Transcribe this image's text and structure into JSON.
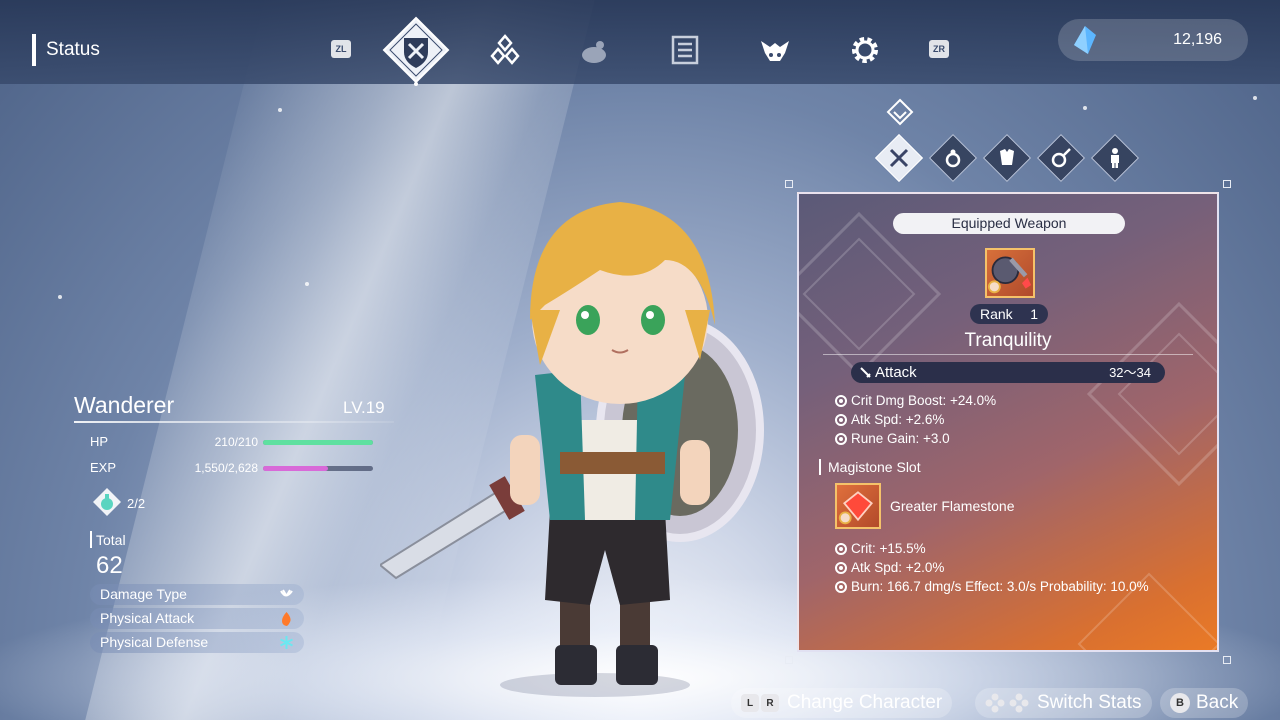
{
  "header": {
    "title": "Status",
    "tabs": [
      {
        "id": "zl",
        "label": "ZL"
      },
      {
        "id": "status",
        "icon": "shield-crossed-swords-icon"
      },
      {
        "id": "gems",
        "icon": "diamond-cluster-icon"
      },
      {
        "id": "pet",
        "icon": "creature-icon"
      },
      {
        "id": "journal",
        "icon": "list-book-icon"
      },
      {
        "id": "monster",
        "icon": "winged-beast-icon"
      },
      {
        "id": "settings",
        "icon": "gear-icon"
      },
      {
        "id": "zr",
        "label": "ZR"
      }
    ],
    "currency": {
      "icon": "crystal-icon",
      "value": "12,196"
    }
  },
  "character": {
    "name": "Wanderer",
    "level": "LV.19",
    "hp_label": "HP",
    "hp_value": "210/210",
    "hp_fill": 1.0,
    "exp_label": "EXP",
    "exp_value": "1,550/2,628",
    "exp_fill": 0.59,
    "orb_count": "2/2",
    "total_label": "Total",
    "total_value": "62",
    "attributes": [
      {
        "label": "Damage Type",
        "icon": "claw-icon"
      },
      {
        "label": "Physical Attack",
        "icon": "fire-icon"
      },
      {
        "label": "Physical Defense",
        "icon": "snowflake-icon"
      }
    ]
  },
  "subtabs": [
    {
      "id": "weapon",
      "icon": "crossed-swords-icon",
      "active": true
    },
    {
      "id": "accessory",
      "icon": "ring-icon"
    },
    {
      "id": "armor",
      "icon": "armor-icon"
    },
    {
      "id": "cooking",
      "icon": "frying-pan-icon"
    },
    {
      "id": "costume",
      "icon": "person-icon"
    }
  ],
  "panel": {
    "header": "Equipped Weapon",
    "rank_label": "Rank",
    "rank_value": "1",
    "weapon_name": "Tranquility",
    "attack_label": "Attack",
    "attack_value": "32～34",
    "weapon_stats": [
      "Crit Dmg Boost: +24.0%",
      "Atk Spd: +2.6%",
      "Rune Gain: +3.0"
    ],
    "magistone_title": "Magistone Slot",
    "magistone_name": "Greater Flamestone",
    "magistone_stats": [
      "Crit: +15.5%",
      "Atk Spd: +2.0%",
      "Burn: 166.7 dmg/s Effect: 3.0/s Probability: 10.0%"
    ]
  },
  "footer": {
    "change_keys": [
      "L",
      "R"
    ],
    "change_label": "Change Character",
    "switch_label": "Switch Stats",
    "back_key": "B",
    "back_label": "Back"
  },
  "colors": {
    "hp_bar": "#5fe0a0",
    "exp_bar": "#d86ad8",
    "panel_start": "#5b5a78",
    "panel_end": "#ea7a26"
  }
}
